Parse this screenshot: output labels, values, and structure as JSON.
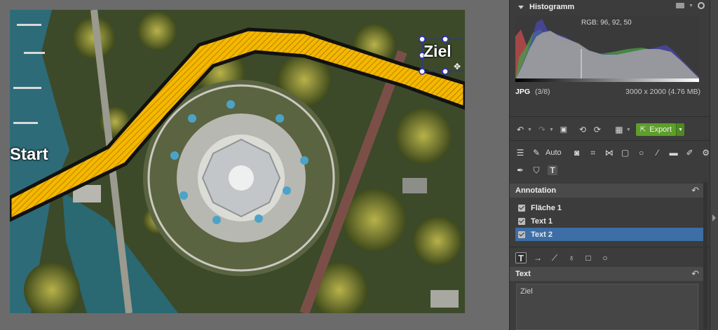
{
  "canvas": {
    "labels": {
      "start": "Start",
      "goal": "Ziel"
    }
  },
  "histogram": {
    "title": "Histogramm",
    "rgb_readout": "RGB: 96, 92, 50"
  },
  "file": {
    "format": "JPG",
    "index": "(3/8)",
    "dimensions": "3000 x 2000 (4.76 MB)"
  },
  "toolbar": {
    "export_label": "Export",
    "auto_label": "Auto"
  },
  "annotation": {
    "title": "Annotation",
    "layers": [
      {
        "label": "Fläche 1",
        "checked": true,
        "selected": false
      },
      {
        "label": "Text 1",
        "checked": true,
        "selected": false
      },
      {
        "label": "Text 2",
        "checked": true,
        "selected": true
      }
    ]
  },
  "text_section": {
    "title": "Text",
    "value": "Ziel"
  },
  "colors": {
    "path_fill": "#f5b700",
    "path_outline": "#111111",
    "selection": "#3d6ea5",
    "export_green": "#5e9e2a",
    "handle": "#2a2ad0"
  }
}
